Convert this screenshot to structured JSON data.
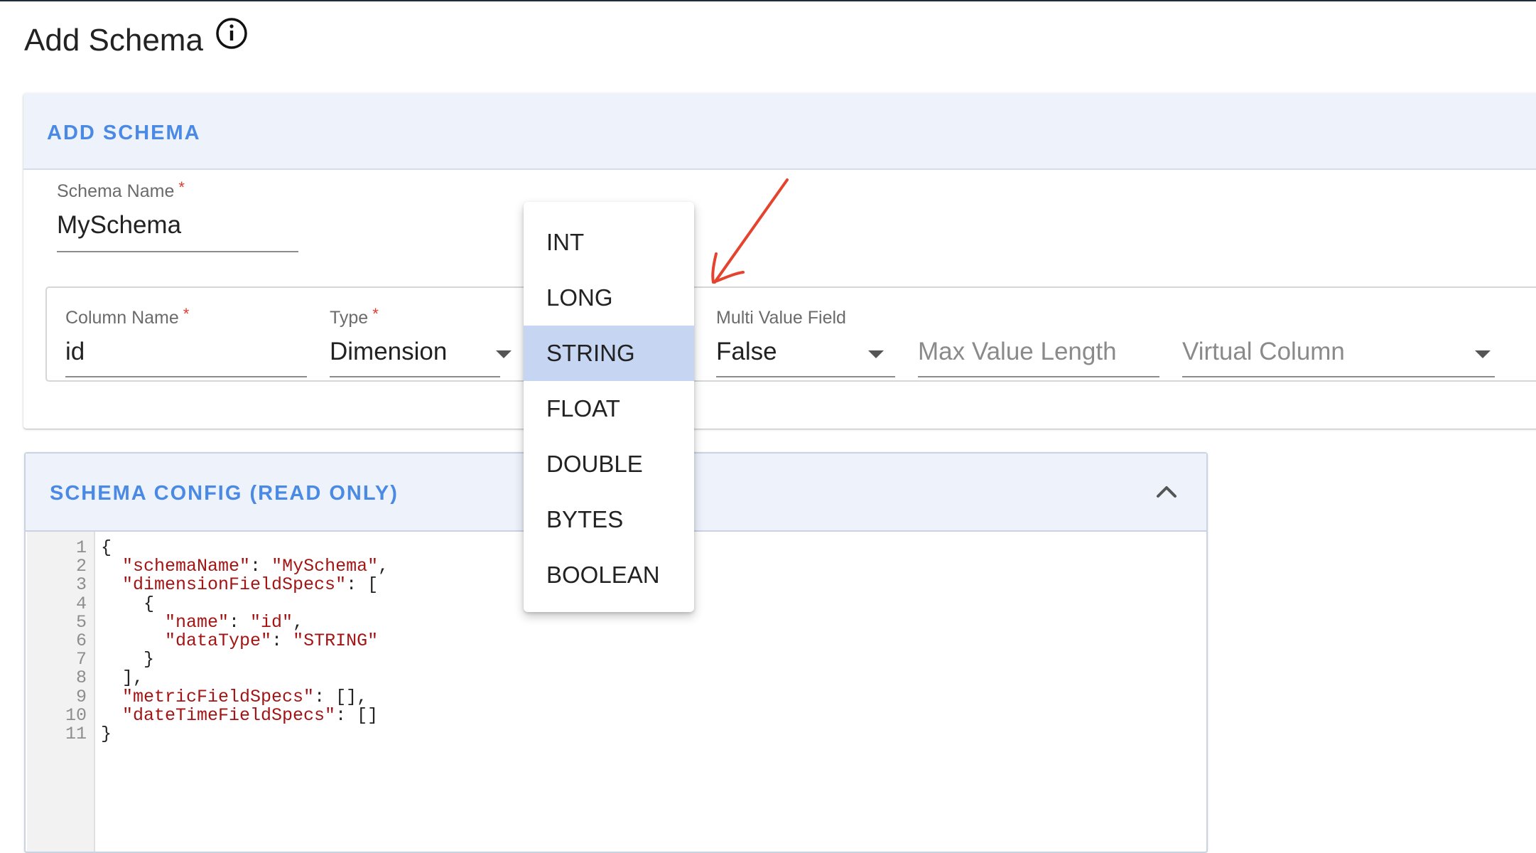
{
  "page": {
    "title": "Add Schema"
  },
  "card": {
    "header": "ADD SCHEMA"
  },
  "schema_name": {
    "label": "Schema Name",
    "required_mark": "*",
    "value": "MySchema"
  },
  "column": {
    "name": {
      "label": "Column Name",
      "required_mark": "*",
      "value": "id"
    },
    "type": {
      "label": "Type",
      "required_mark": "*",
      "value": "Dimension"
    },
    "multi_value": {
      "label": "Multi Value Field",
      "value": "False"
    },
    "max_length": {
      "placeholder": "Max Value Length"
    },
    "virtual": {
      "placeholder": "Virtual Column"
    }
  },
  "menu": {
    "items": [
      "INT",
      "LONG",
      "STRING",
      "FLOAT",
      "DOUBLE",
      "BYTES",
      "BOOLEAN"
    ],
    "selected": "STRING"
  },
  "schema_config": {
    "title": "SCHEMA CONFIG (READ ONLY)",
    "lines": [
      {
        "n": "1",
        "indent": "",
        "key": "",
        "val": "",
        "text": "{"
      },
      {
        "n": "2",
        "indent": "  ",
        "key": "\"schemaName\"",
        "sep": ": ",
        "val": "\"MySchema\"",
        "tail": ","
      },
      {
        "n": "3",
        "indent": "  ",
        "key": "\"dimensionFieldSpecs\"",
        "sep": ": ",
        "val": "",
        "tail": "["
      },
      {
        "n": "4",
        "indent": "    ",
        "key": "",
        "val": "",
        "text": "{"
      },
      {
        "n": "5",
        "indent": "      ",
        "key": "\"name\"",
        "sep": ": ",
        "val": "\"id\"",
        "tail": ","
      },
      {
        "n": "6",
        "indent": "      ",
        "key": "\"dataType\"",
        "sep": ": ",
        "val": "\"STRING\"",
        "tail": ""
      },
      {
        "n": "7",
        "indent": "    ",
        "key": "",
        "val": "",
        "text": "}"
      },
      {
        "n": "8",
        "indent": "  ",
        "key": "",
        "val": "",
        "text": "],"
      },
      {
        "n": "9",
        "indent": "  ",
        "key": "\"metricFieldSpecs\"",
        "sep": ": ",
        "val": "",
        "tail": "[],"
      },
      {
        "n": "10",
        "indent": "  ",
        "key": "\"dateTimeFieldSpecs\"",
        "sep": ": ",
        "val": "",
        "tail": "[]"
      },
      {
        "n": "11",
        "indent": "",
        "key": "",
        "val": "",
        "text": "}"
      }
    ]
  },
  "icons": {
    "info": "info-circle-icon",
    "caret": "arrow-drop-down-icon",
    "collapse": "chevron-up-icon",
    "annotation": "red-arrow-annotation"
  },
  "colors": {
    "accent": "#4a8ae4",
    "header_bg": "#edf2fb",
    "selected_bg": "#c6d6f2",
    "required": "#e03a2f",
    "annotation": "#e5432d",
    "string": "#a31515"
  }
}
